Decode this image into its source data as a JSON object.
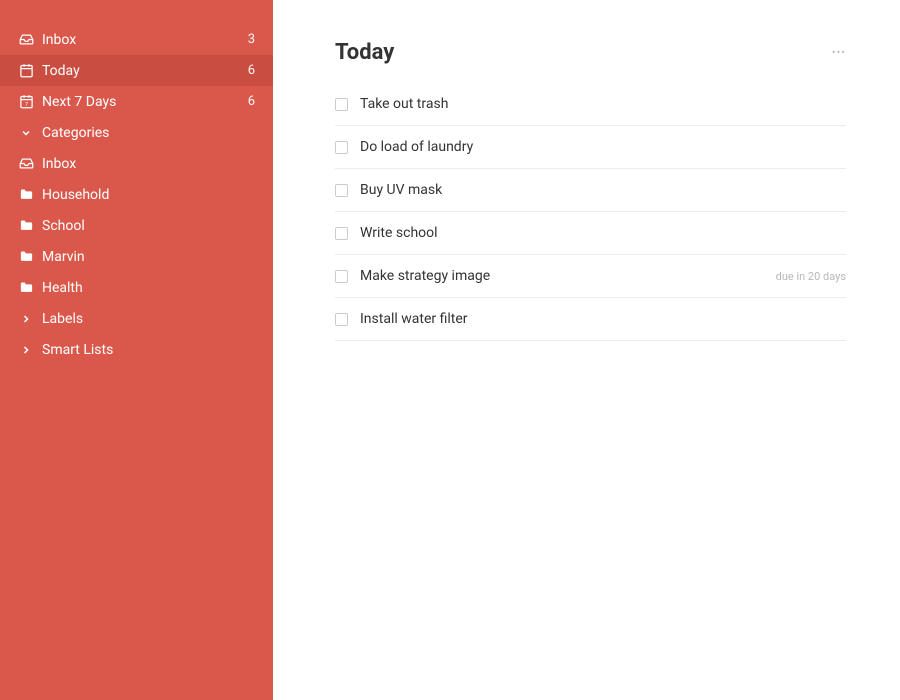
{
  "colors": {
    "sidebar": "#DA584B",
    "sidebar_active": "#C94E41"
  },
  "sidebar": {
    "items": [
      {
        "icon": "inbox-icon",
        "label": "Inbox",
        "count": "3",
        "active": false
      },
      {
        "icon": "calendar-today-icon",
        "label": "Today",
        "count": "6",
        "active": true
      },
      {
        "icon": "calendar-week-icon",
        "label": "Next 7 Days",
        "count": "6",
        "active": false
      },
      {
        "icon": "chevron-down-icon",
        "label": "Categories",
        "count": "",
        "active": false
      },
      {
        "icon": "inbox-icon",
        "label": "Inbox",
        "count": "",
        "active": false
      },
      {
        "icon": "folder-icon",
        "label": "Household",
        "count": "",
        "active": false
      },
      {
        "icon": "folder-icon",
        "label": "School",
        "count": "",
        "active": false
      },
      {
        "icon": "folder-icon",
        "label": "Marvin",
        "count": "",
        "active": false
      },
      {
        "icon": "folder-icon",
        "label": "Health",
        "count": "",
        "active": false
      },
      {
        "icon": "chevron-right-icon",
        "label": "Labels",
        "count": "",
        "active": false
      },
      {
        "icon": "chevron-right-icon",
        "label": "Smart Lists",
        "count": "",
        "active": false
      }
    ]
  },
  "main": {
    "title": "Today",
    "tasks": [
      {
        "label": "Take out trash",
        "due": ""
      },
      {
        "label": "Do load of laundry",
        "due": ""
      },
      {
        "label": "Buy UV  mask",
        "due": ""
      },
      {
        "label": "Write school",
        "due": ""
      },
      {
        "label": "Make strategy image",
        "due": "due in 20 days"
      },
      {
        "label": "Install water filter",
        "due": ""
      }
    ]
  }
}
